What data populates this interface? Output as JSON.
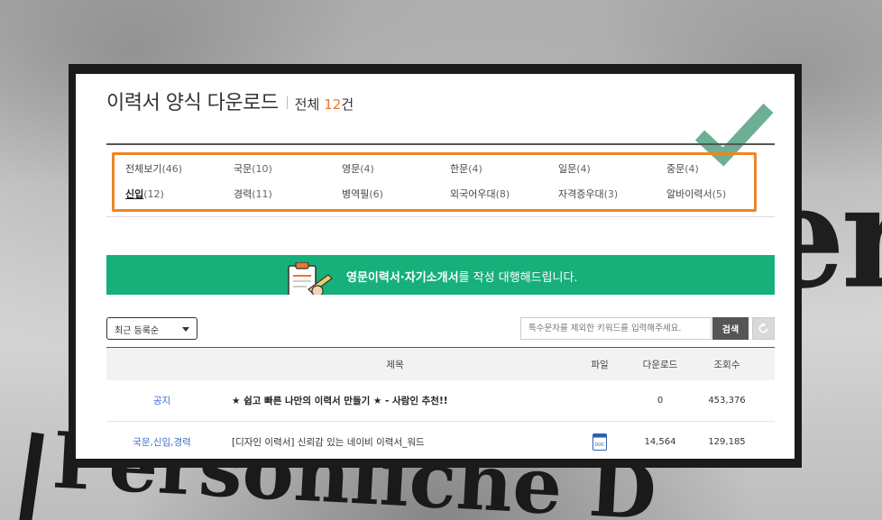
{
  "background": {
    "text_right": "er",
    "text_bottom": "Persönliche D"
  },
  "header": {
    "title": "이력서 양식 다운로드",
    "total_label": "전체",
    "total_count": "12",
    "total_unit": "건"
  },
  "categories": [
    {
      "label": "전체보기",
      "count": "(46)"
    },
    {
      "label": "국문",
      "count": "(10)"
    },
    {
      "label": "영문",
      "count": "(4)"
    },
    {
      "label": "한문",
      "count": "(4)"
    },
    {
      "label": "일문",
      "count": "(4)"
    },
    {
      "label": "중문",
      "count": "(4)"
    },
    {
      "label": "신입",
      "count": "(12)",
      "active": true
    },
    {
      "label": "경력",
      "count": "(11)"
    },
    {
      "label": "병역필",
      "count": "(6)"
    },
    {
      "label": "외국어우대",
      "count": "(8)"
    },
    {
      "label": "자격증우대",
      "count": "(3)"
    },
    {
      "label": "알바이력서",
      "count": "(5)"
    }
  ],
  "banner": {
    "text_bold": "영문이력서·자기소개서",
    "text_rest": "를 작성 대행해드립니다.",
    "color": "#17b07b"
  },
  "toolbar": {
    "sort_value": "최근 등록순",
    "search_placeholder": "특수문자를 제외한 키워드를 입력해주세요.",
    "search_label": "검색"
  },
  "table": {
    "headers": {
      "title": "제목",
      "file": "파일",
      "downloads": "다운로드",
      "views": "조회수"
    },
    "rows": [
      {
        "category": "공지",
        "title": "★ 쉽고 빠른 나만의 이력서 만들기 ★ - 사람인 추천!!",
        "file": "",
        "downloads": "0",
        "views": "453,376"
      },
      {
        "category": "국문,신입,경력",
        "title": "[디자인 이력서] 신뢰감 있는 네이비 이력서_워드",
        "file": "doc-icon",
        "downloads": "14,564",
        "views": "129,185"
      }
    ]
  },
  "colors": {
    "accent_orange": "#ee8527",
    "check_green": "#5fa88a"
  }
}
